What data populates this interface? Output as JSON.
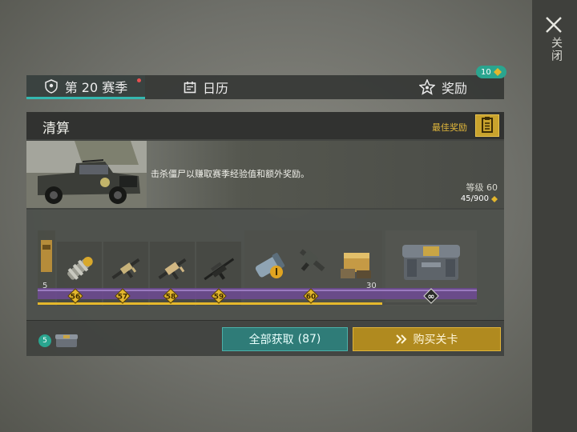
{
  "close": {
    "label": "关闭"
  },
  "tabs": {
    "season": "第 20 赛季",
    "calendar": "日历",
    "rewards": "奖励",
    "rewards_badge": "10"
  },
  "panel": {
    "title": "清算",
    "best_rewards": "最佳奖励",
    "description": "击杀僵尸以赚取赛季经验值和额外奖励。",
    "level_label": "等级 60",
    "xp": "45/900",
    "xp_fraction": 0.05
  },
  "track": {
    "partial_count": "5",
    "levels": [
      "56",
      "57",
      "58",
      "59",
      "60"
    ],
    "bundle_count": "30",
    "infinite_symbol": "∞"
  },
  "footer": {
    "crate_count": "5",
    "claim_all": "全部获取",
    "claim_count": "(87)",
    "buy_pass": "购买关卡"
  },
  "colors": {
    "accent_teal": "#34b8b0",
    "gold": "#e3b62d",
    "purple": "#7a4fa0"
  }
}
